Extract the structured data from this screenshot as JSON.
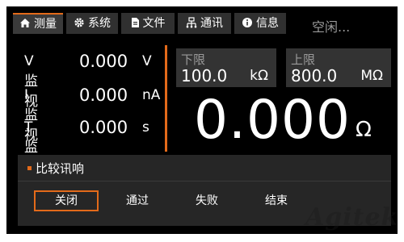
{
  "tabs": [
    {
      "label": "测量",
      "icon": "home-icon",
      "active": true
    },
    {
      "label": "系统",
      "icon": "gear-icon",
      "active": false
    },
    {
      "label": "文件",
      "icon": "document-icon",
      "active": false
    },
    {
      "label": "通讯",
      "icon": "network-icon",
      "active": false
    },
    {
      "label": "信息",
      "icon": "info-icon",
      "active": false
    }
  ],
  "status": "空闲...",
  "readings": [
    {
      "label": "V 监视",
      "value": "0.000",
      "unit": "V"
    },
    {
      "label": "I 监视",
      "value": "0.000",
      "unit": "nA"
    },
    {
      "label": "T 监视",
      "value": "0.000",
      "unit": "s"
    }
  ],
  "lower_limit": {
    "title": "下限",
    "value": "100.0",
    "unit": "kΩ"
  },
  "upper_limit": {
    "title": "上限",
    "value": "800.0",
    "unit": "MΩ"
  },
  "main_value": "0.000",
  "main_unit": "Ω",
  "compare": {
    "title": "比较讯响",
    "options": [
      "关闭",
      "通过",
      "失败",
      "结束"
    ],
    "selected": "关闭"
  },
  "watermark": "Agitek",
  "colors": {
    "accent": "#e36a1a",
    "background": "#000000",
    "panel": "#262626"
  }
}
